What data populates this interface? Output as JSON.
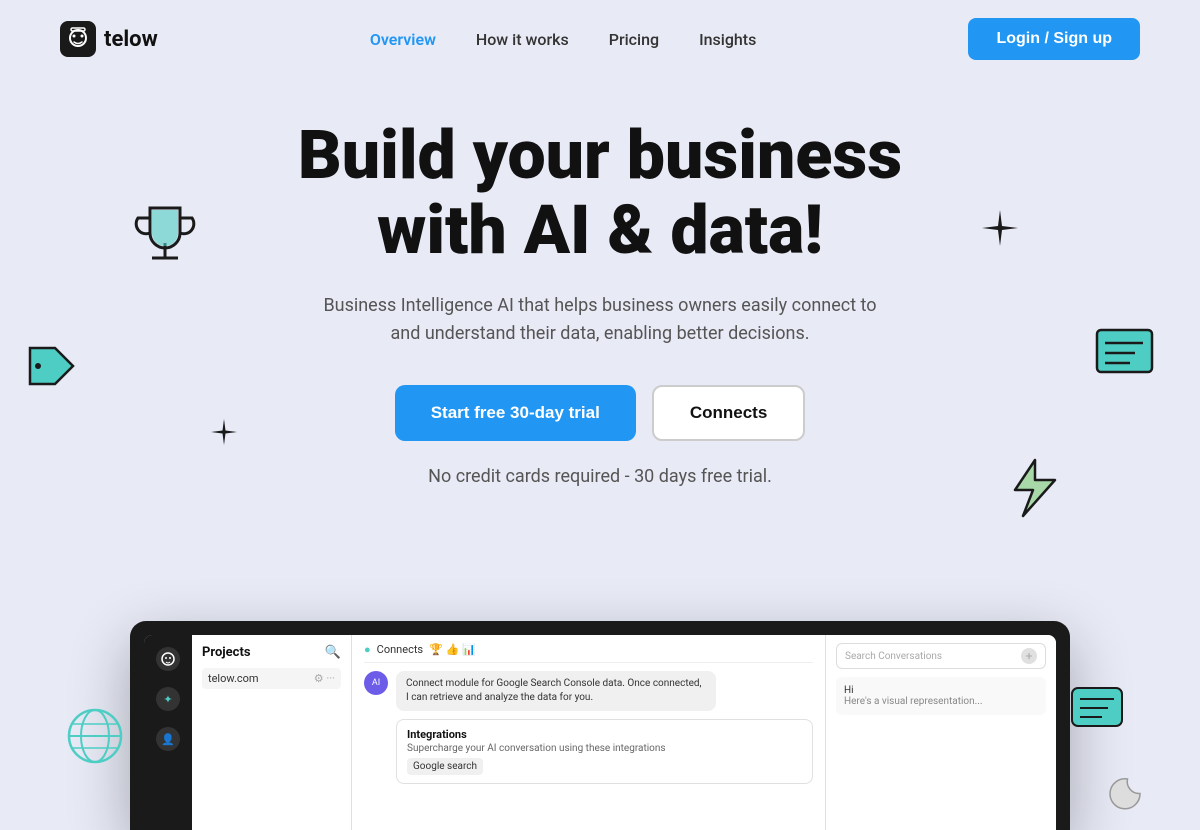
{
  "logo": {
    "text": "telow"
  },
  "nav": {
    "links": [
      {
        "label": "Overview",
        "active": true
      },
      {
        "label": "How it works",
        "active": false
      },
      {
        "label": "Pricing",
        "active": false
      },
      {
        "label": "Insights",
        "active": false
      }
    ],
    "loginLabel": "Login / Sign up"
  },
  "hero": {
    "headline_line1": "Build your business",
    "headline_line2": "with AI & data!",
    "subtext": "Business Intelligence AI that helps business owners easily connect to and understand their data, enabling better decisions.",
    "cta_primary": "Start free 30-day trial",
    "cta_secondary": "Connects",
    "no_card": "No credit cards required - 30 days free trial."
  },
  "app_preview": {
    "projects_title": "Projects",
    "project_item": "telow.com",
    "connects_label": "Connects",
    "chat_message": "Connect module for Google Search Console data. Once connected, I can retrieve and analyze the data for you.",
    "search_placeholder": "Search Conversations",
    "right_message_line1": "Hi",
    "right_message_line2": "Here's a visual representation...",
    "integrations_title": "Integrations",
    "integrations_sub": "Supercharge your AI conversation using these integrations",
    "google_search_label": "Google search"
  }
}
